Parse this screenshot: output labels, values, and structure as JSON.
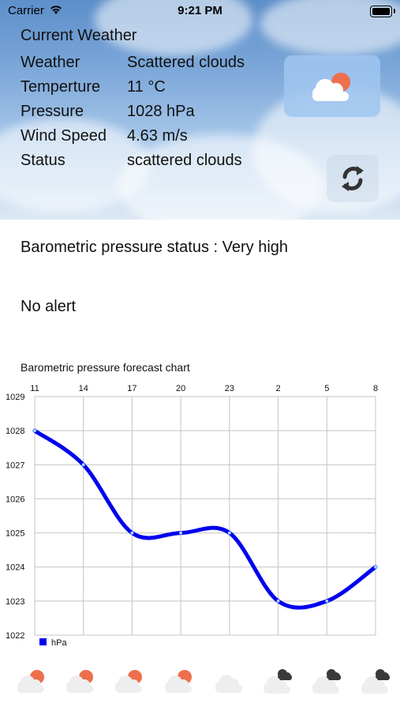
{
  "status_bar": {
    "carrier": "Carrier",
    "time": "9:21 PM"
  },
  "current": {
    "title": "Current Weather",
    "rows": [
      {
        "label": "Weather",
        "value": "Scattered clouds"
      },
      {
        "label": "Temperture",
        "value": "11 °C"
      },
      {
        "label": "Pressure",
        "value": "1028 hPa"
      },
      {
        "label": "Wind Speed",
        "value": "4.63 m/s"
      },
      {
        "label": "Status",
        "value": "scattered clouds"
      }
    ],
    "icon": "partly-cloudy-icon"
  },
  "pressure_status": "Barometric pressure status : Very high",
  "alert": "No alert",
  "chart_caption": "Barometric pressure forecast chart",
  "chart_data": {
    "type": "line",
    "x": [
      "11",
      "14",
      "17",
      "20",
      "23",
      "2",
      "5",
      "8"
    ],
    "series": [
      {
        "name": "hPa",
        "values": [
          1028,
          1027,
          1025,
          1025,
          1025,
          1023,
          1023,
          1024
        ],
        "color": "#0000ee"
      }
    ],
    "ylim": [
      1022,
      1029
    ],
    "yticks": [
      "1022",
      "1023",
      "1024",
      "1025",
      "1026",
      "1027",
      "1028",
      "1029"
    ],
    "grid": true,
    "legend": "bottom-left"
  },
  "forecast_icons": [
    "partly-cloudy-icon",
    "partly-cloudy-icon",
    "partly-cloudy-icon",
    "partly-cloudy-icon",
    "cloud-icon",
    "broken-clouds-icon",
    "broken-clouds-icon",
    "broken-clouds-icon"
  ]
}
